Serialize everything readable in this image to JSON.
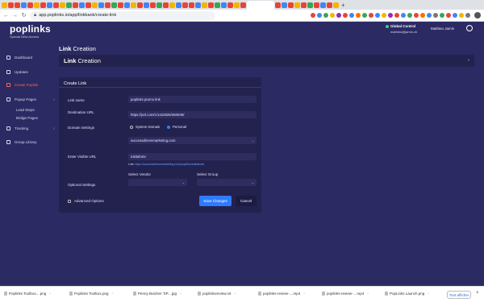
{
  "browser": {
    "url": "app.poplinks.io/app/linkbank/create-link",
    "profile_initial": ""
  },
  "app": {
    "logo": "poplinks",
    "logo_sub": "Special Beta Access",
    "global_control_title": "Global Control",
    "global_control_email": "mathieu@jamin.ch",
    "user_name": "Mathieu Jamin"
  },
  "sidebar": {
    "items": [
      {
        "label": "Dashboard"
      },
      {
        "label": "Updates"
      },
      {
        "label": "Create Poplink"
      },
      {
        "label": "Popup Pages"
      },
      {
        "label": "Lead Steps"
      },
      {
        "label": "Bridge Pages"
      },
      {
        "label": "Tracking"
      },
      {
        "label": "Group Library"
      }
    ]
  },
  "main": {
    "page_title_bold": "Link",
    "page_title_rest": "Creation",
    "accordion_bold": "Link",
    "accordion_rest": "Creation",
    "card_title": "Create Link",
    "fields": {
      "link_name_label": "Link name",
      "link_name_value": "poplinks promo link",
      "destination_label": "Destination URL",
      "destination_value": "https://jvzl.com/c/1422925/360039/",
      "domain_label": "Domain Settings",
      "domain_option_system": "System Domain",
      "domain_option_personal": "Personal",
      "domain_select_value": "successdrivenmarketing.com",
      "friendly_label": "Enter Visible URL",
      "friendly_value": "tokitaforte",
      "link_preview_prefix": "Link:",
      "link_preview_url": "https://successdrivenmarketing.com/poplinks/tokitaforte",
      "optional_label": "Optional Settings",
      "vendor_label": "Select Vendor",
      "group_label": "Select Group",
      "advanced_label": "Advanced Options",
      "save_label": "Save Changes",
      "cancel_label": "Cancel"
    }
  },
  "downloads": [
    {
      "name": "Poplinks Toolbox....png"
    },
    {
      "name": "Poplinks Toolbox.png"
    },
    {
      "name": "Penny Butcher 'SP....jpg"
    },
    {
      "name": "poplinksreview.srt"
    },
    {
      "name": "poplinks-review-....mp4"
    },
    {
      "name": "poplinks-review-....mp4"
    },
    {
      "name": "PopLinks Launch.png"
    }
  ],
  "downloads_show_all": "Tout afficher",
  "colors": {
    "background": "#2b2a63",
    "panel": "#23224f",
    "accent_active": "#ff6a3d",
    "primary_button": "#2f7bff",
    "status_dot": "#33d17a"
  }
}
